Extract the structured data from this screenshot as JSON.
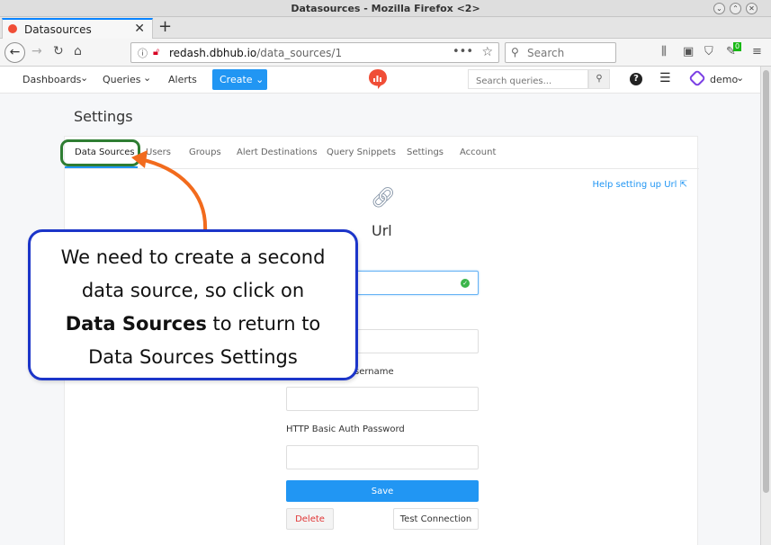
{
  "window": {
    "title": "Datasources - Mozilla Firefox <2>"
  },
  "browser": {
    "tab_title": "Datasources",
    "new_tab_label": "+",
    "url_host": "redash.dbhub.io",
    "url_path": "/data_sources/1",
    "search_placeholder": "Search",
    "extension_badge": "0"
  },
  "app": {
    "nav": {
      "dashboards": "Dashboards",
      "queries": "Queries",
      "alerts": "Alerts",
      "create": "Create"
    },
    "search_placeholder": "Search queries...",
    "user": "demo",
    "accent_color": "#2196f3"
  },
  "settings": {
    "title": "Settings",
    "tabs": [
      "Data Sources",
      "Users",
      "Groups",
      "Alert Destinations",
      "Query Snippets",
      "Settings",
      "Account"
    ],
    "help_link": "Help setting up Url",
    "data_source_type": "Url",
    "fields": {
      "username_label_partial": "sername",
      "password_label": "HTTP Basic Auth Password"
    },
    "buttons": {
      "save": "Save",
      "delete": "Delete",
      "test": "Test Connection"
    }
  },
  "annotation": {
    "line1": "We need to create a second",
    "line2": "data source, so click on",
    "line3_bold": "Data Sources",
    "line3_rest": " to return to",
    "line4": "Data Sources Settings",
    "ring_color": "#2e7d32",
    "arrow_color": "#f26b1d",
    "border_color": "#1c35c9"
  }
}
